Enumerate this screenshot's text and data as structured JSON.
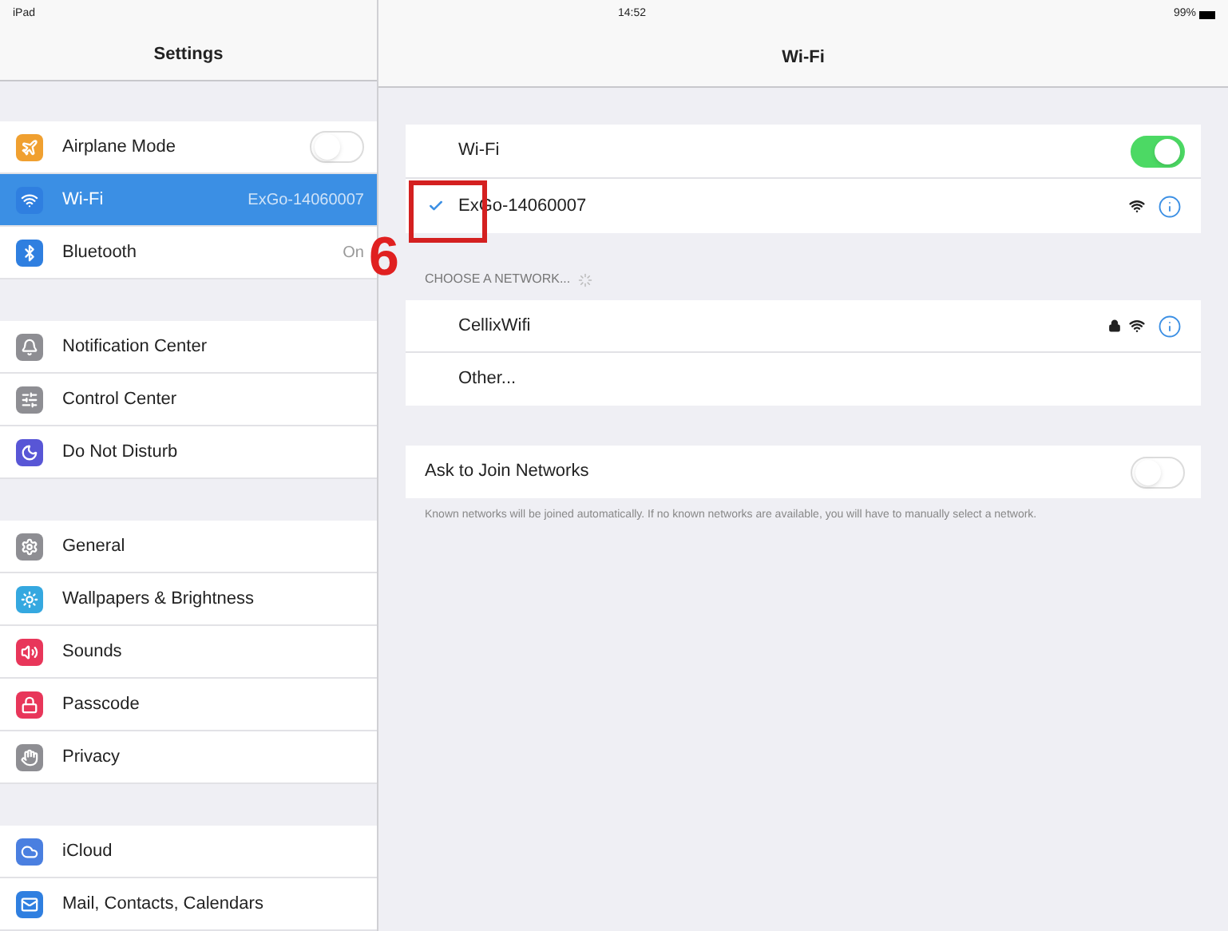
{
  "status_bar": {
    "device": "iPad",
    "time": "14:52",
    "battery": "99%"
  },
  "sidebar": {
    "title": "Settings",
    "groups": [
      {
        "items": [
          {
            "label": "Airplane Mode",
            "kind": "toggle",
            "on": false,
            "selected": false,
            "color": "#f0a030"
          },
          {
            "label": "Wi-Fi",
            "kind": "value",
            "value": "ExGo-14060007",
            "selected": true,
            "color": "#2f7fe0"
          },
          {
            "label": "Bluetooth",
            "kind": "value",
            "value": "On",
            "selected": false,
            "color": "#2f7fe0"
          }
        ]
      },
      {
        "items": [
          {
            "label": "Notification Center",
            "kind": "plain",
            "selected": false,
            "color": "#8e8e93"
          },
          {
            "label": "Control Center",
            "kind": "plain",
            "selected": false,
            "color": "#8e8e93"
          },
          {
            "label": "Do Not Disturb",
            "kind": "plain",
            "selected": false,
            "color": "#5856d6"
          }
        ]
      },
      {
        "items": [
          {
            "label": "General",
            "kind": "plain",
            "selected": false,
            "color": "#8e8e93"
          },
          {
            "label": "Wallpapers & Brightness",
            "kind": "plain",
            "selected": false,
            "color": "#35a8e0"
          },
          {
            "label": "Sounds",
            "kind": "plain",
            "selected": false,
            "color": "#e8365a"
          },
          {
            "label": "Passcode",
            "kind": "plain",
            "selected": false,
            "color": "#e8365a"
          },
          {
            "label": "Privacy",
            "kind": "plain",
            "selected": false,
            "color": "#8e8e93"
          }
        ]
      },
      {
        "items": [
          {
            "label": "iCloud",
            "kind": "plain",
            "selected": false,
            "color": "#4a7fe0"
          },
          {
            "label": "Mail, Contacts, Calendars",
            "kind": "plain",
            "selected": false,
            "color": "#2f7fe0"
          }
        ]
      }
    ]
  },
  "detail": {
    "title": "Wi-Fi",
    "wifi": {
      "label": "Wi-Fi",
      "on": true
    },
    "connected": {
      "name": "ExGo-14060007",
      "checked": true
    },
    "choose_header": "CHOOSE A NETWORK...",
    "networks": [
      {
        "kind": "network",
        "name": "CellixWifi",
        "locked": true
      },
      {
        "kind": "other",
        "name": "Other..."
      }
    ],
    "ask_to_join": {
      "label": "Ask to Join Networks",
      "on": false
    },
    "footer": "Known networks will be joined automatically. If no known networks are available, you will have to manually select a network."
  },
  "annotation": {
    "label": "6"
  }
}
